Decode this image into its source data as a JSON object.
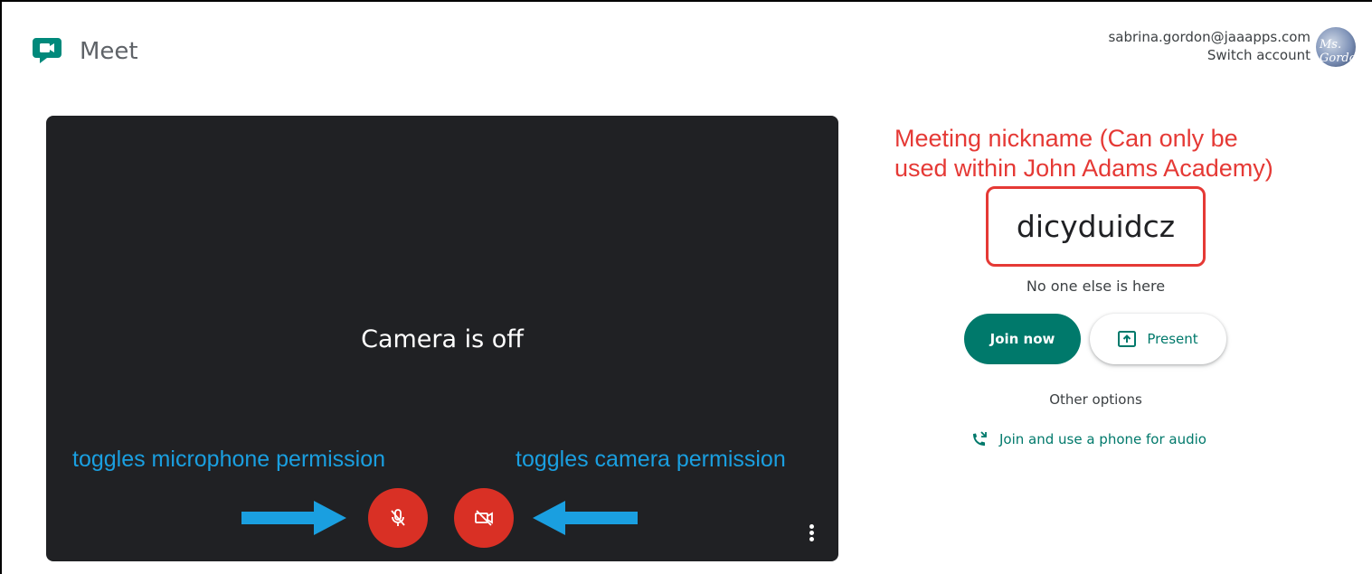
{
  "header": {
    "app_name": "Meet",
    "account_email": "sabrina.gordon@jaaapps.com",
    "switch_account": "Switch account",
    "avatar_text": "Ms. Gordon"
  },
  "preview": {
    "camera_status": "Camera is off",
    "mic_annotation": "toggles microphone permission",
    "camera_annotation": "toggles camera permission"
  },
  "panel": {
    "nickname_note_line1": "Meeting nickname (Can only be",
    "nickname_note_line2": "used within John Adams Academy)",
    "meeting_code": "dicyduidcz",
    "status": "No one else is here",
    "join_label": "Join now",
    "present_label": "Present",
    "other_options": "Other options",
    "phone_audio": "Join and use a phone for audio"
  },
  "colors": {
    "brand_green": "#00796b",
    "danger_red": "#d93025",
    "annotation_red": "#e53935",
    "annotation_blue": "#1a9fe0",
    "preview_bg": "#202124"
  },
  "icons": [
    "meet-logo-icon",
    "mic-off-icon",
    "camera-off-icon",
    "more-vert-icon",
    "present-screen-icon",
    "phone-audio-icon"
  ]
}
